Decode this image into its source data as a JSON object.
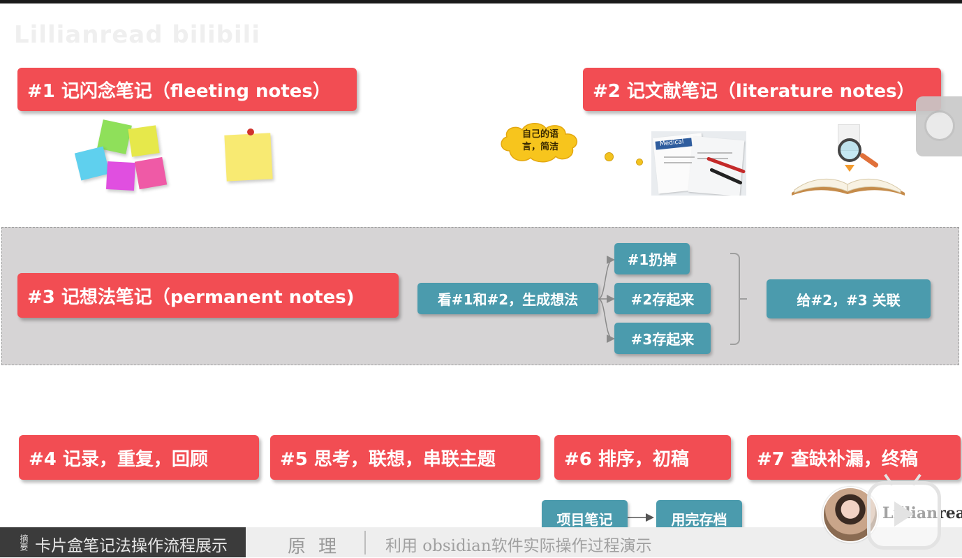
{
  "watermark": "Lillianread bilibili",
  "step1": {
    "label": "#1 记闪念笔记（fleeting notes）"
  },
  "step2": {
    "label": "#2 记文献笔记（literature notes）"
  },
  "step3": {
    "label": "#3 记想法笔记（permanent notes)"
  },
  "cloud": {
    "text_line1": "自己的语",
    "text_line2": "言，简洁"
  },
  "document_tag": "Medical",
  "flow": {
    "source": "看#1和#2，生成想法",
    "branches": [
      "#1扔掉",
      "#2存起来",
      "#3存起来"
    ],
    "link": "给#2，#3 关联"
  },
  "steps_bottom": [
    "#4 记录，重复，回顾",
    "#5 思考，联想，串联主题",
    "#6 排序，初稿",
    "#7 查缺补漏，终稿"
  ],
  "project_flow": {
    "from": "项目笔记",
    "to": "用完存档"
  },
  "presenter_name": "Lillianread",
  "bottom_bar": {
    "tab1": "摘要",
    "title": "卡片盒笔记法操作流程展示",
    "tab2": "原理",
    "subtitle": "利用 obsidian软件实际操作过程演示"
  },
  "colors": {
    "red": "#f24d53",
    "teal": "#4b9bad",
    "band": "#d6d4d5"
  },
  "icons": [
    "sticky-notes-cluster-icon",
    "pinned-note-icon",
    "thought-cloud-icon",
    "documents-pen-icon",
    "open-book-magnifier-icon",
    "play-tv-icon"
  ]
}
